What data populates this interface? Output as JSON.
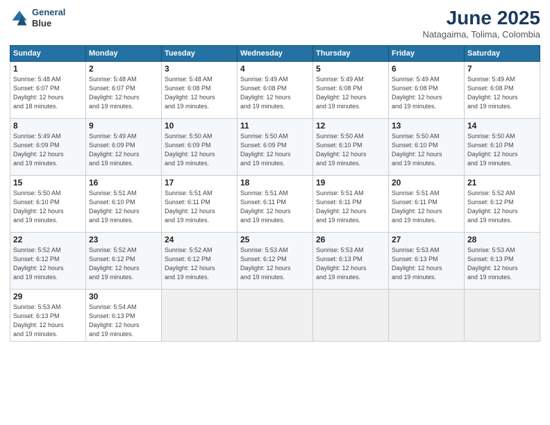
{
  "header": {
    "logo_line1": "General",
    "logo_line2": "Blue",
    "month_year": "June 2025",
    "location": "Natagaima, Tolima, Colombia"
  },
  "days_of_week": [
    "Sunday",
    "Monday",
    "Tuesday",
    "Wednesday",
    "Thursday",
    "Friday",
    "Saturday"
  ],
  "weeks": [
    [
      {
        "num": "1",
        "rise": "5:48 AM",
        "set": "6:07 PM",
        "daylight": "12 hours and 18 minutes."
      },
      {
        "num": "2",
        "rise": "5:48 AM",
        "set": "6:07 PM",
        "daylight": "12 hours and 19 minutes."
      },
      {
        "num": "3",
        "rise": "5:48 AM",
        "set": "6:08 PM",
        "daylight": "12 hours and 19 minutes."
      },
      {
        "num": "4",
        "rise": "5:49 AM",
        "set": "6:08 PM",
        "daylight": "12 hours and 19 minutes."
      },
      {
        "num": "5",
        "rise": "5:49 AM",
        "set": "6:08 PM",
        "daylight": "12 hours and 19 minutes."
      },
      {
        "num": "6",
        "rise": "5:49 AM",
        "set": "6:08 PM",
        "daylight": "12 hours and 19 minutes."
      },
      {
        "num": "7",
        "rise": "5:49 AM",
        "set": "6:08 PM",
        "daylight": "12 hours and 19 minutes."
      }
    ],
    [
      {
        "num": "8",
        "rise": "5:49 AM",
        "set": "6:09 PM",
        "daylight": "12 hours and 19 minutes."
      },
      {
        "num": "9",
        "rise": "5:49 AM",
        "set": "6:09 PM",
        "daylight": "12 hours and 19 minutes."
      },
      {
        "num": "10",
        "rise": "5:50 AM",
        "set": "6:09 PM",
        "daylight": "12 hours and 19 minutes."
      },
      {
        "num": "11",
        "rise": "5:50 AM",
        "set": "6:09 PM",
        "daylight": "12 hours and 19 minutes."
      },
      {
        "num": "12",
        "rise": "5:50 AM",
        "set": "6:10 PM",
        "daylight": "12 hours and 19 minutes."
      },
      {
        "num": "13",
        "rise": "5:50 AM",
        "set": "6:10 PM",
        "daylight": "12 hours and 19 minutes."
      },
      {
        "num": "14",
        "rise": "5:50 AM",
        "set": "6:10 PM",
        "daylight": "12 hours and 19 minutes."
      }
    ],
    [
      {
        "num": "15",
        "rise": "5:50 AM",
        "set": "6:10 PM",
        "daylight": "12 hours and 19 minutes."
      },
      {
        "num": "16",
        "rise": "5:51 AM",
        "set": "6:10 PM",
        "daylight": "12 hours and 19 minutes."
      },
      {
        "num": "17",
        "rise": "5:51 AM",
        "set": "6:11 PM",
        "daylight": "12 hours and 19 minutes."
      },
      {
        "num": "18",
        "rise": "5:51 AM",
        "set": "6:11 PM",
        "daylight": "12 hours and 19 minutes."
      },
      {
        "num": "19",
        "rise": "5:51 AM",
        "set": "6:11 PM",
        "daylight": "12 hours and 19 minutes."
      },
      {
        "num": "20",
        "rise": "5:51 AM",
        "set": "6:11 PM",
        "daylight": "12 hours and 19 minutes."
      },
      {
        "num": "21",
        "rise": "5:52 AM",
        "set": "6:12 PM",
        "daylight": "12 hours and 19 minutes."
      }
    ],
    [
      {
        "num": "22",
        "rise": "5:52 AM",
        "set": "6:12 PM",
        "daylight": "12 hours and 19 minutes."
      },
      {
        "num": "23",
        "rise": "5:52 AM",
        "set": "6:12 PM",
        "daylight": "12 hours and 19 minutes."
      },
      {
        "num": "24",
        "rise": "5:52 AM",
        "set": "6:12 PM",
        "daylight": "12 hours and 19 minutes."
      },
      {
        "num": "25",
        "rise": "5:53 AM",
        "set": "6:12 PM",
        "daylight": "12 hours and 19 minutes."
      },
      {
        "num": "26",
        "rise": "5:53 AM",
        "set": "6:13 PM",
        "daylight": "12 hours and 19 minutes."
      },
      {
        "num": "27",
        "rise": "5:53 AM",
        "set": "6:13 PM",
        "daylight": "12 hours and 19 minutes."
      },
      {
        "num": "28",
        "rise": "5:53 AM",
        "set": "6:13 PM",
        "daylight": "12 hours and 19 minutes."
      }
    ],
    [
      {
        "num": "29",
        "rise": "5:53 AM",
        "set": "6:13 PM",
        "daylight": "12 hours and 19 minutes."
      },
      {
        "num": "30",
        "rise": "5:54 AM",
        "set": "6:13 PM",
        "daylight": "12 hours and 19 minutes."
      },
      null,
      null,
      null,
      null,
      null
    ]
  ]
}
